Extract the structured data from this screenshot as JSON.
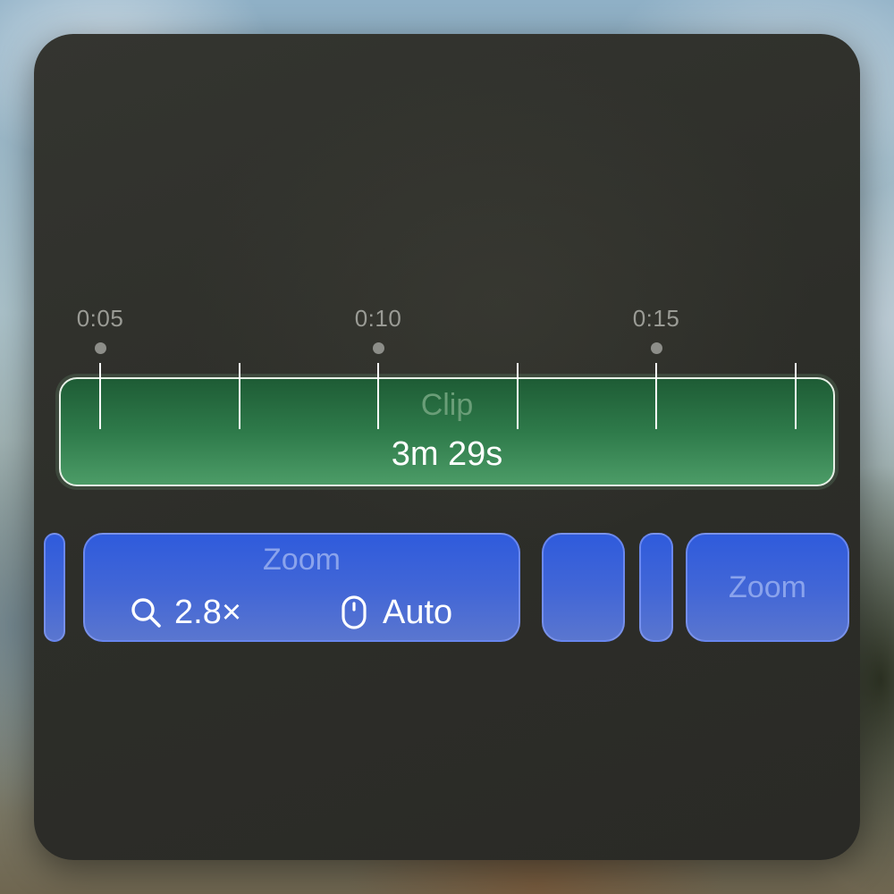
{
  "timeline": {
    "ticks": [
      {
        "label": "0:05"
      },
      {
        "label": "0:10"
      },
      {
        "label": "0:15"
      }
    ]
  },
  "clip": {
    "title": "Clip",
    "duration": "3m 29s",
    "color": "#2e7a4a"
  },
  "zoom_segments": [
    {
      "title": "Zoom",
      "scale": "2.8×",
      "mode": "Auto",
      "color": "#3f63d8"
    },
    {
      "title": "Zoom"
    }
  ],
  "icons": {
    "scale": "magnifier-icon",
    "mode": "mouse-icon"
  }
}
